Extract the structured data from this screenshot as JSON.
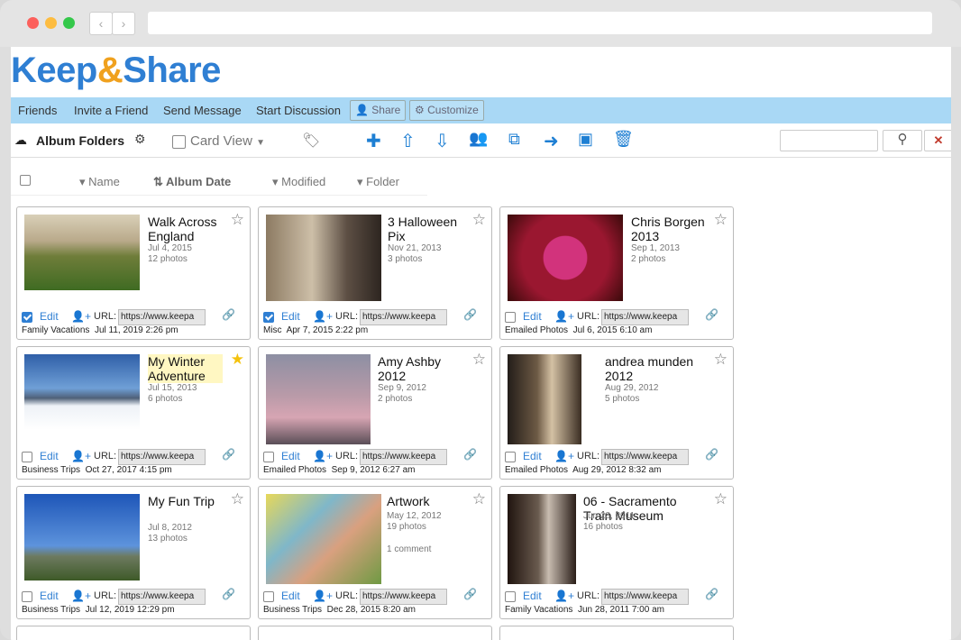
{
  "app": {
    "logo_a": "Keep",
    "logo_amp": "&",
    "logo_b": "Share"
  },
  "menu": {
    "friends": "Friends",
    "invite": "Invite a Friend",
    "send": "Send Message",
    "discussion": "Start Discussion",
    "share": "Share",
    "customize": "Customize"
  },
  "toolbar": {
    "title": "Album Folders",
    "view": "Card View"
  },
  "sort": {
    "name": "Name",
    "album_date": "Album Date",
    "modified": "Modified",
    "folder": "Folder"
  },
  "cards": [
    {
      "title": "Walk Across England",
      "date": "Jul 4, 2015",
      "count": "12 photos",
      "extra": "",
      "checked": true,
      "fav": false,
      "url": "https://www.keepa",
      "folder": "Family Vacations",
      "modified": "Jul 11, 2019 2:26 pm"
    },
    {
      "title": "3 Halloween Pix",
      "date": "Nov 21, 2013",
      "count": "3 photos",
      "extra": "",
      "checked": true,
      "fav": false,
      "url": "https://www.keepa",
      "folder": "Misc",
      "modified": "Apr 7, 2015 2:22 pm"
    },
    {
      "title": "Chris Borgen 2013",
      "date": "Sep 1, 2013",
      "count": "2 photos",
      "extra": "",
      "checked": false,
      "fav": false,
      "url": "https://www.keepa",
      "folder": "Emailed Photos",
      "modified": "Jul 6, 2015 6:10 am"
    },
    {
      "title": "My Winter Adventure",
      "date": "Jul 15, 2013",
      "count": "6 photos",
      "extra": "",
      "checked": false,
      "fav": true,
      "url": "https://www.keepa",
      "folder": "Business Trips",
      "modified": "Oct 27, 2017 4:15 pm"
    },
    {
      "title": "Amy Ashby 2012",
      "date": "Sep 9, 2012",
      "count": "2 photos",
      "extra": "",
      "checked": false,
      "fav": false,
      "url": "https://www.keepa",
      "folder": "Emailed Photos",
      "modified": "Sep 9, 2012 6:27 am"
    },
    {
      "title": "andrea munden 2012",
      "date": "Aug 29, 2012",
      "count": "5 photos",
      "extra": "",
      "checked": false,
      "fav": false,
      "url": "https://www.keepa",
      "folder": "Emailed Photos",
      "modified": "Aug 29, 2012 8:32 am"
    },
    {
      "title": "My Fun Trip",
      "date": "Jul 8, 2012",
      "count": "13 photos",
      "extra": "",
      "checked": false,
      "fav": false,
      "url": "https://www.keepa",
      "folder": "Business Trips",
      "modified": "Jul 12, 2019 12:29 pm"
    },
    {
      "title": "Artwork",
      "date": "May 12, 2012",
      "count": "19 photos",
      "extra": "1 comment",
      "checked": false,
      "fav": false,
      "url": "https://www.keepa",
      "folder": "Business Trips",
      "modified": "Dec 28, 2015 8:20 am"
    },
    {
      "title": "06 - Sacramento Train Museum",
      "date": "Jun 28, 2011",
      "count": "16 photos",
      "extra": "",
      "checked": false,
      "fav": false,
      "url": "https://www.keepa",
      "folder": "Family Vacations",
      "modified": "Jun 28, 2011 7:00 am"
    }
  ],
  "labels": {
    "edit": "Edit",
    "url": "URL:"
  },
  "colors": {
    "brand_blue": "#2f7fd3",
    "brand_orange": "#f0a11e",
    "menubar": "#a9d8f5"
  }
}
